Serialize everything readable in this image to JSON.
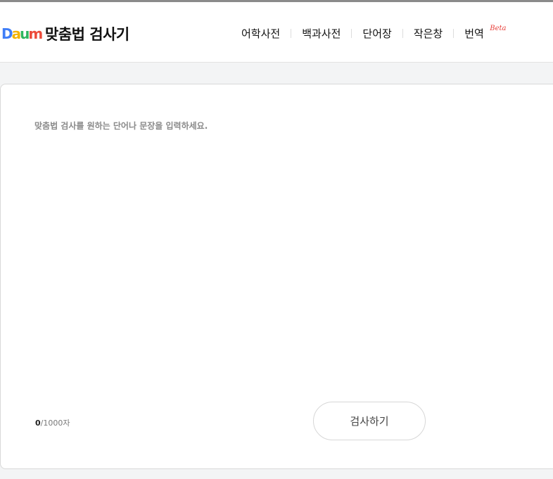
{
  "header": {
    "logo_letters": [
      {
        "char": "D",
        "color": "#3f7ef7"
      },
      {
        "char": "a",
        "color": "#f4b400"
      },
      {
        "char": "u",
        "color": "#2fb55e"
      },
      {
        "char": "m",
        "color": "#ec4b3a"
      }
    ],
    "logo_label": "Daum",
    "service_title": "맞춤법 검사기",
    "nav": [
      {
        "label": "어학사전"
      },
      {
        "label": "백과사전"
      },
      {
        "label": "단어장"
      },
      {
        "label": "작은창"
      },
      {
        "label": "번역",
        "badge": "Beta"
      }
    ]
  },
  "main": {
    "input_placeholder": "맞춤법 검사를 원하는 단어나 문장을 입력하세요.",
    "input_value": "",
    "char_count": "0",
    "char_limit": "/1000자",
    "check_button_label": "검사하기"
  },
  "colors": {
    "badge": "#e8413b",
    "page_background": "#f3f4f5"
  }
}
